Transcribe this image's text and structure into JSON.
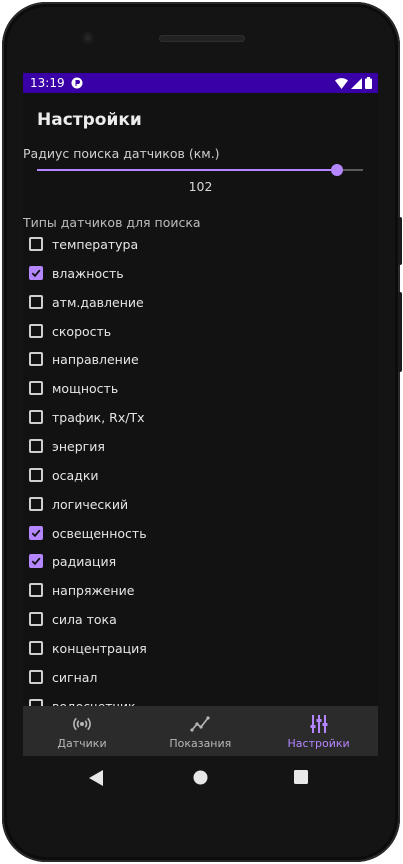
{
  "status_bar": {
    "time": "13:19",
    "left_icon": "app-notification-icon",
    "icons": [
      "wifi-icon",
      "signal-icon",
      "battery-icon"
    ]
  },
  "header": {
    "title": "Настройки"
  },
  "search_radius": {
    "label": "Радиус поиска датчиков (км.)",
    "value": "102",
    "fraction": 0.92
  },
  "sensor_types": {
    "label": "Типы датчиков для поиска",
    "items": [
      {
        "label": "температура",
        "checked": false
      },
      {
        "label": "влажность",
        "checked": true
      },
      {
        "label": "атм.давление",
        "checked": false
      },
      {
        "label": "скорость",
        "checked": false
      },
      {
        "label": "направление",
        "checked": false
      },
      {
        "label": "мощность",
        "checked": false
      },
      {
        "label": "трафик, Rx/Tx",
        "checked": false
      },
      {
        "label": "энергия",
        "checked": false
      },
      {
        "label": "осадки",
        "checked": false
      },
      {
        "label": "логический",
        "checked": false
      },
      {
        "label": "освещенность",
        "checked": true
      },
      {
        "label": "радиация",
        "checked": true
      },
      {
        "label": "напряжение",
        "checked": false
      },
      {
        "label": "сила тока",
        "checked": false
      },
      {
        "label": "концентрация",
        "checked": false
      },
      {
        "label": "сигнал",
        "checked": false
      },
      {
        "label": "водосчетчик",
        "checked": false
      }
    ]
  },
  "bottom_nav": {
    "items": [
      {
        "label": "Датчики",
        "icon": "sensor-broadcast-icon",
        "active": false
      },
      {
        "label": "Показания",
        "icon": "chart-line-icon",
        "active": false
      },
      {
        "label": "Настройки",
        "icon": "tune-sliders-icon",
        "active": true
      }
    ]
  },
  "colors": {
    "accent": "#b486ff",
    "status_bar": "#3a00a8",
    "background": "#121212",
    "nav_background": "#2b2b2b"
  }
}
